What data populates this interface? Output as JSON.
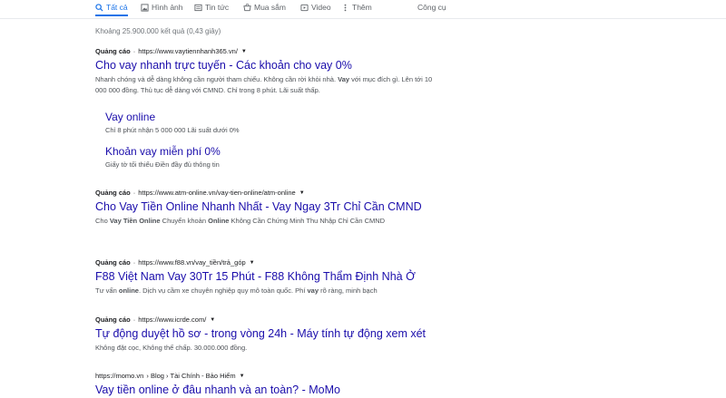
{
  "tabs": [
    {
      "label": "Tất cả",
      "icon": "search-icon",
      "active": true
    },
    {
      "label": "Hình ảnh",
      "icon": "image-icon"
    },
    {
      "label": "Tin tức",
      "icon": "news-icon"
    },
    {
      "label": "Mua sắm",
      "icon": "shopping-icon"
    },
    {
      "label": "Video",
      "icon": "video-icon"
    },
    {
      "label": "Thêm",
      "icon": "more-icon"
    }
  ],
  "tools_label": "Công cụ",
  "stats": "Khoảng 25.900.000 kết quả (0,43 giây)",
  "results": [
    {
      "ad_label": "Quảng cáo",
      "url": "https://www.vaytiennhanh365.vn/",
      "title": "Cho vay nhanh trực tuyến - Các khoản cho vay 0%",
      "snippet_parts": [
        "Nhanh chóng và dễ dàng không cần người tham chiếu. Không cần rời khỏi nhà. ",
        "Vay",
        " với mục đích gì. Lên tới 10 000 000 đồng. Thủ tục dễ dàng với CMND. Chỉ trong 8 phút. Lãi suất thấp."
      ],
      "sitelinks": [
        {
          "title": "Vay online",
          "desc": "Chỉ 8 phút nhận 5 000 000 Lãi suất dưới 0%"
        },
        {
          "title": "Khoản vay miễn phí 0%",
          "desc": "Giấy tờ tối thiểu Điền đầy đủ thông tin"
        }
      ]
    },
    {
      "ad_label": "Quảng cáo",
      "url": "https://www.atm-online.vn/vay-tien-online/atm-online",
      "title": "Cho Vay Tiền Online Nhanh Nhất - Vay Ngay 3Tr Chỉ Cần CMND",
      "snippet_parts": [
        "Cho ",
        "Vay Tiền Online",
        " Chuyển khoản ",
        "Online",
        " Không Cần Chứng Minh Thu Nhập Chỉ Cần CMND"
      ]
    },
    {
      "ad_label": "Quảng cáo",
      "url": "https://www.f88.vn/vay_tiền/trả_góp",
      "title": "F88 Việt Nam Vay 30Tr 15 Phút - F88 Không Thẩm Định Nhà Ở",
      "snippet_parts": [
        "Tư vấn ",
        "online",
        ". Dịch vụ cầm xe chuyên nghiệp quy mô toàn quốc. Phí ",
        "vay",
        " rõ ràng, minh bạch"
      ]
    },
    {
      "ad_label": "Quảng cáo",
      "url": "https://www.icrde.com/",
      "title": "Tự động duyệt hồ sơ - trong vòng 24h - Máy tính tự động xem xét",
      "snippet_parts": [
        "Không đặt cọc, Không thế chấp. 30.000.000 đồng."
      ]
    },
    {
      "url": "https://momo.vn",
      "breadcrumb": "› Blog › Tài Chính - Bảo Hiểm",
      "title": "Vay tiền online ở đâu nhanh và an toàn? - MoMo"
    }
  ]
}
